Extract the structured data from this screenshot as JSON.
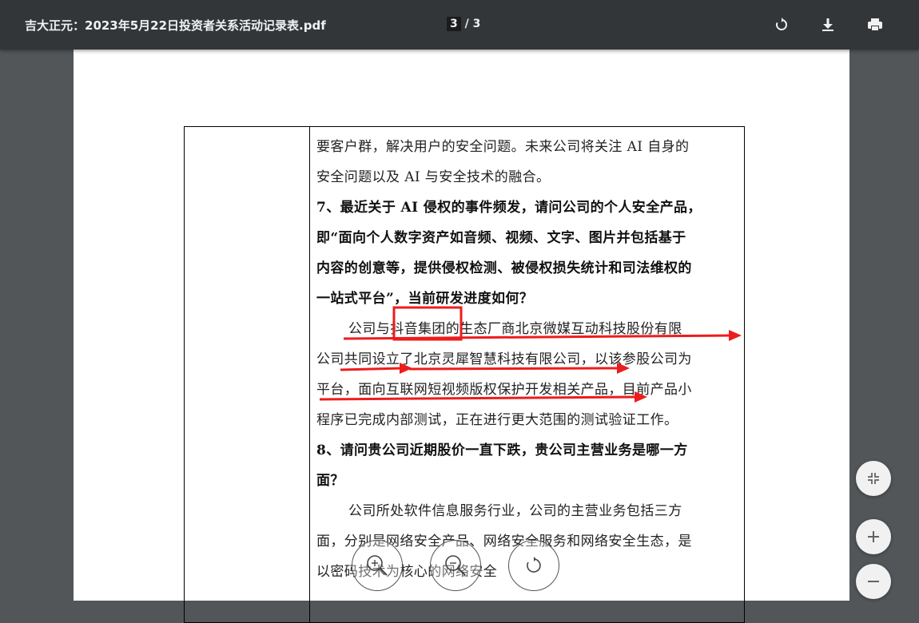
{
  "toolbar": {
    "title": "吉大正元：2023年5月22日投资者关系活动记录表.pdf",
    "page_current": "3",
    "page_sep_total": " / 3",
    "icons": [
      "rotate-icon",
      "download-icon",
      "print-icon"
    ]
  },
  "document": {
    "paragraphs": [
      {
        "style": "normal",
        "text": "要客户群，解决用户的安全问题。未来公司将关注 AI 自身的"
      },
      {
        "style": "normal",
        "text": "安全问题以及 AI 与安全技术的融合。"
      },
      {
        "style": "bold",
        "text": "7、最近关于 AI 侵权的事件频发，请问公司的个人安全产品，"
      },
      {
        "style": "bold",
        "text": "即“面向个人数字资产如音频、视频、文字、图片并包括基于"
      },
      {
        "style": "bold",
        "text": "内容的创意等，提供侵权检测、被侵权损失统计和司法维权的"
      },
      {
        "style": "bold",
        "text": "一站式平台”，当前研发进度如何？"
      },
      {
        "style": "indent",
        "text": "公司与抖音集团的生态厂商北京微媒互动科技股份有限"
      },
      {
        "style": "normal",
        "text": "公司共同设立了北京灵犀智慧科技有限公司，以该参股公司为"
      },
      {
        "style": "normal",
        "text": "平台，面向互联网短视频版权保护开发相关产品，目前产品小"
      },
      {
        "style": "normal",
        "text": "程序已完成内部测试，正在进行更大范围的测试验证工作。"
      },
      {
        "style": "bold",
        "text": "8、请问贵公司近期股价一直下跌，贵公司主营业务是哪一方"
      },
      {
        "style": "bold",
        "text": "面？"
      },
      {
        "style": "indent",
        "text": "公司所处软件信息服务行业，公司的主营业务包括三方"
      },
      {
        "style": "normal",
        "text": "面，分别是网络安全产品、网络安全服务和网络安全生态，是"
      },
      {
        "style": "normal",
        "text": "以密码技术为核心的网络安全"
      }
    ]
  },
  "annotation": {
    "highlight_color": "#ee1c1c",
    "boxed_text": "抖音集团"
  },
  "controls": {
    "fit_icon": "fit-page-icon",
    "zoom_in_icon": "zoom-in-icon",
    "zoom_out_icon": "zoom-out-icon",
    "overlay": [
      "magnifier-plus-icon",
      "magnifier-minus-icon",
      "rotate-view-icon"
    ]
  }
}
